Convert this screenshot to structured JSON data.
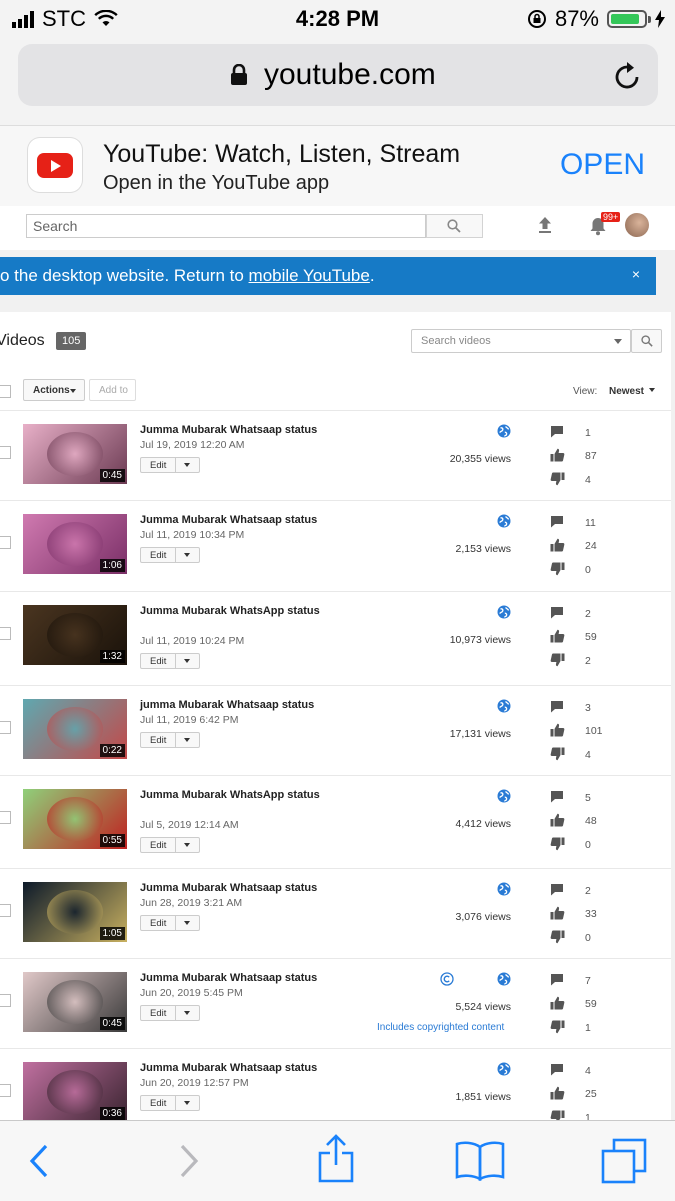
{
  "status_bar": {
    "carrier": "STC",
    "time": "4:28 PM",
    "battery": "87%",
    "battery_level": 0.87,
    "battery_color": "#34c759"
  },
  "browser": {
    "url": "youtube.com"
  },
  "app_banner": {
    "title": "YouTube: Watch, Listen, Stream",
    "subtitle": "Open in the YouTube app",
    "open_label": "OPEN"
  },
  "yt_header": {
    "search_placeholder": "Search",
    "notification_count": "99+"
  },
  "notice": {
    "text": "o the desktop website. Return to ",
    "link": "mobile YouTube",
    "suffix": ".",
    "close": "×"
  },
  "videos": {
    "title": "Videos",
    "count": "105",
    "search_placeholder": "Search videos",
    "actions_label": "Actions",
    "add_to_label": "Add to",
    "view_label": "View:",
    "sort_label": "Newest",
    "edit_label": "Edit",
    "items": [
      {
        "title": "Jumma Mubarak Whatsaap status",
        "date": "Jul 19, 2019 12:20 AM",
        "duration": "0:45",
        "views": "20,355 views",
        "comments": "1",
        "likes": "87",
        "dislikes": "4",
        "colors": [
          "#e8b0c8",
          "#6b3a52"
        ]
      },
      {
        "title": "Jumma Mubarak Whatsaap status",
        "date": "Jul 11, 2019 10:34 PM",
        "duration": "1:06",
        "views": "2,153 views",
        "comments": "11",
        "likes": "24",
        "dislikes": "0",
        "colors": [
          "#d07ab0",
          "#7a2f67"
        ]
      },
      {
        "title": "Jumma Mubarak WhatsApp status",
        "date": "Jul 11, 2019 10:24 PM",
        "duration": "1:32",
        "views": "10,973 views",
        "comments": "2",
        "likes": "59",
        "dislikes": "2",
        "colors": [
          "#4a3520",
          "#1a120a"
        ]
      },
      {
        "title": "jumma Mubarak Whatsaap status",
        "date": "Jul 11, 2019 6:42 PM",
        "duration": "0:22",
        "views": "17,131 views",
        "comments": "3",
        "likes": "101",
        "dislikes": "4",
        "colors": [
          "#5fa8b0",
          "#c44848"
        ]
      },
      {
        "title": "Jumma Mubarak WhatsApp status",
        "date": "Jul 5, 2019 12:14 AM",
        "duration": "0:55",
        "views": "4,412 views",
        "comments": "5",
        "likes": "48",
        "dislikes": "0",
        "colors": [
          "#8fd07a",
          "#c02020"
        ]
      },
      {
        "title": "Jumma Mubarak Whatsaap status",
        "date": "Jun 28, 2019 3:21 AM",
        "duration": "1:05",
        "views": "3,076 views",
        "comments": "2",
        "likes": "33",
        "dislikes": "0",
        "colors": [
          "#0d1a2a",
          "#c8b060"
        ]
      },
      {
        "title": "Jumma Mubarak Whatsaap status",
        "date": "Jun 20, 2019 5:45 PM",
        "duration": "0:45",
        "views": "5,524 views",
        "comments": "7",
        "likes": "59",
        "dislikes": "1",
        "colors": [
          "#e0c8c8",
          "#3a3a3a"
        ],
        "copyright_note": "Includes copyrighted content"
      },
      {
        "title": "Jumma Mubarak Whatsaap status",
        "date": "Jun 20, 2019 12:57 PM",
        "duration": "0:36",
        "views": "1,851 views",
        "comments": "4",
        "likes": "25",
        "dislikes": "1",
        "colors": [
          "#c070a0",
          "#3a2430"
        ]
      }
    ]
  }
}
